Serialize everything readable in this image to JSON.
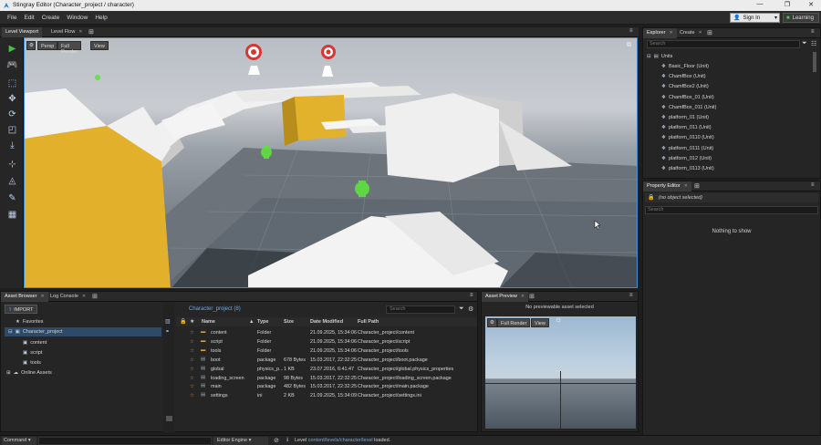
{
  "window": {
    "title": "Stingray Editor (Character_project / character)",
    "controls": [
      "—",
      "❐",
      "✕"
    ]
  },
  "menu": [
    "File",
    "Edit",
    "Create",
    "Window",
    "Help"
  ],
  "account": {
    "signin": "Sign In",
    "learning": "Learning"
  },
  "viewport_tabs": [
    {
      "label": "Level Viewport"
    },
    {
      "label": "Level Flow"
    }
  ],
  "viewport_toolbar": {
    "mode": "Persp",
    "full_render": "Full Render",
    "view": "View"
  },
  "explorer": {
    "tabs": [
      "Explorer",
      "Create"
    ],
    "search_placeholder": "Search",
    "root": "Units",
    "items": [
      "Basic_Floor (Unit)",
      "ChamfBox (Unit)",
      "ChamfBox2 (Unit)",
      "ChamfBox_01 (Unit)",
      "ChamfBox_011 (Unit)",
      "platform_01 (Unit)",
      "platform_011 (Unit)",
      "platform_0110 (Unit)",
      "platform_0111 (Unit)",
      "platform_012 (Unit)",
      "platform_0113 (Unit)"
    ]
  },
  "property_editor": {
    "tab": "Property Editor",
    "selection": "(no object selected)",
    "search_placeholder": "Search",
    "empty": "Nothing to show"
  },
  "asset_browser": {
    "tabs": [
      "Asset Browser",
      "Log Console"
    ],
    "import": "IMPORT",
    "favorites": "Favorites",
    "project": "Character_project",
    "folders": [
      "content",
      "script",
      "tools"
    ],
    "online": "Online Assets",
    "breadcrumb": "Character_project (8)",
    "search_placeholder": "Search",
    "columns": [
      "Name",
      "Type",
      "Size",
      "Date Modified",
      "Full Path"
    ],
    "rows": [
      {
        "name": "content",
        "type": "Folder",
        "size": "",
        "date": "21.09.2025, 15:34:06",
        "path": "Character_project/content",
        "icon": "folder"
      },
      {
        "name": "script",
        "type": "Folder",
        "size": "",
        "date": "21.09.2025, 15:34:06",
        "path": "Character_project/script",
        "icon": "folder"
      },
      {
        "name": "tools",
        "type": "Folder",
        "size": "",
        "date": "21.09.2025, 15:34:06",
        "path": "Character_project/tools",
        "icon": "folder"
      },
      {
        "name": "boot",
        "type": "package",
        "size": "678 Bytes",
        "date": "15.03.2017, 22:32:25",
        "path": "Character_project/boot.package",
        "icon": "file"
      },
      {
        "name": "global",
        "type": "physics_p...",
        "size": "1 KB",
        "date": "23.07.2016, 6:41:47",
        "path": "Character_project/global.physics_properties",
        "icon": "file"
      },
      {
        "name": "loading_screen",
        "type": "package",
        "size": "98 Bytes",
        "date": "15.03.2017, 22:32:25",
        "path": "Character_project/loading_screen.package",
        "icon": "file"
      },
      {
        "name": "main",
        "type": "package",
        "size": "482 Bytes",
        "date": "15.03.2017, 22:32:25",
        "path": "Character_project/main.package",
        "icon": "file"
      },
      {
        "name": "settings",
        "type": "ini",
        "size": "2 KB",
        "date": "21.09.2025, 15:34:09",
        "path": "Character_project/settings.ini",
        "icon": "file"
      }
    ]
  },
  "asset_preview": {
    "tab": "Asset Preview",
    "message": "No previewable asset selected",
    "full_render": "Full Render",
    "view": "View"
  },
  "status": {
    "command": "Command",
    "engine": "Editor Engine",
    "prefix": "Level",
    "link": "content/levels/character/level",
    "suffix": "loaded."
  }
}
